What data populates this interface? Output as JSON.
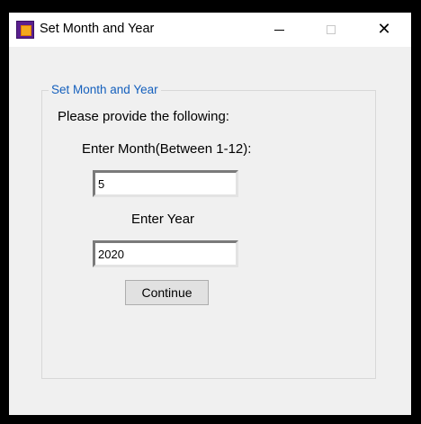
{
  "window": {
    "title": "Set Month and Year",
    "icon": "calendar-app-icon",
    "controls": {
      "minimize": "minimize-icon",
      "maximize": "maximize-icon",
      "close": "close-icon",
      "close_glyph": "✕"
    }
  },
  "form": {
    "group_title": "Set Month and Year",
    "instruction": "Please provide the following:",
    "month_label": "Enter Month(Between 1-12):",
    "month_value": "5",
    "year_label": "Enter Year",
    "year_value": "2020",
    "continue_label": "Continue"
  },
  "colors": {
    "accent": "#1560bd",
    "window_bg": "#f0f0f0",
    "titlebar_bg": "#ffffff"
  }
}
